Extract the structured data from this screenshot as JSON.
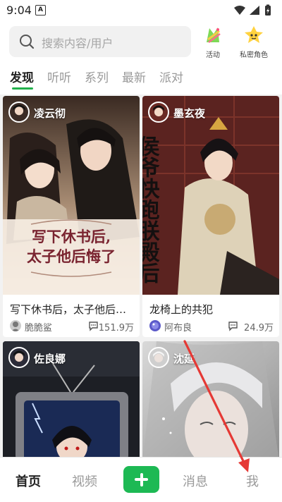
{
  "status_bar": {
    "time": "9:04",
    "notification_glyph": "A"
  },
  "search": {
    "placeholder": "搜索内容/用户",
    "icon": "search-icon"
  },
  "top_actions": [
    {
      "label": "活动",
      "icon": "activity-icon"
    },
    {
      "label": "私密角色",
      "icon": "private-character-icon"
    }
  ],
  "tabs": [
    "发现",
    "听听",
    "系列",
    "最新",
    "派对"
  ],
  "active_tab": "发现",
  "cards": [
    {
      "author": "凌云彻",
      "title": "写下休书后，太子他后悔了",
      "user": "脆脆鲨",
      "count": "151.9万",
      "cover_text": [
        "写下休书后,",
        "太子他后悔了"
      ]
    },
    {
      "author": "墨玄夜",
      "title": "龙椅上的共犯",
      "user": "阿布良",
      "count": "24.9万",
      "cover_text": [
        "侯爷快跑",
        "朕殿后"
      ]
    },
    {
      "author": "佐良娜"
    },
    {
      "author": "沈延"
    }
  ],
  "bottom_nav": {
    "home": "首页",
    "video": "视频",
    "messages": "消息",
    "me": "我"
  },
  "colors": {
    "accent": "#1db954",
    "underline": "#22b14c",
    "annotation_arrow": "#e53935"
  }
}
